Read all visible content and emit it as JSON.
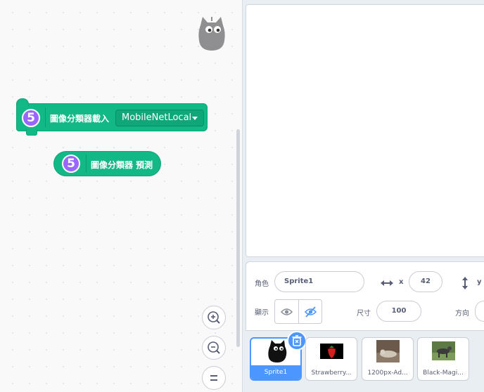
{
  "blocks": {
    "ext_badge": "5",
    "load_label": "圖像分類器載入",
    "load_model_value": "MobileNetLocal",
    "predict_label": "圖像分類器 預測"
  },
  "sprite_info": {
    "sprite_label": "角色",
    "sprite_name": "Sprite1",
    "x_label": "x",
    "x_value": "42",
    "y_label": "y",
    "show_label": "顯示",
    "size_label": "尺寸",
    "size_value": "100",
    "direction_label": "方向"
  },
  "sprites": [
    {
      "name": "Sprite1",
      "selected": true
    },
    {
      "name": "Strawberry..."
    },
    {
      "name": "1200px-Ad..."
    },
    {
      "name": "Black-Magi..."
    }
  ],
  "colors": {
    "extension_green": "#12b886",
    "extension_badge": "#9966ff",
    "selection_blue": "#4c97ff"
  },
  "icons": [
    "zoom-in-icon",
    "zoom-out-icon",
    "zoom-reset-icon",
    "eye-icon",
    "eye-slash-icon",
    "trash-icon",
    "horizontal-arrow-icon",
    "vertical-arrow-icon",
    "mascot-icon"
  ]
}
